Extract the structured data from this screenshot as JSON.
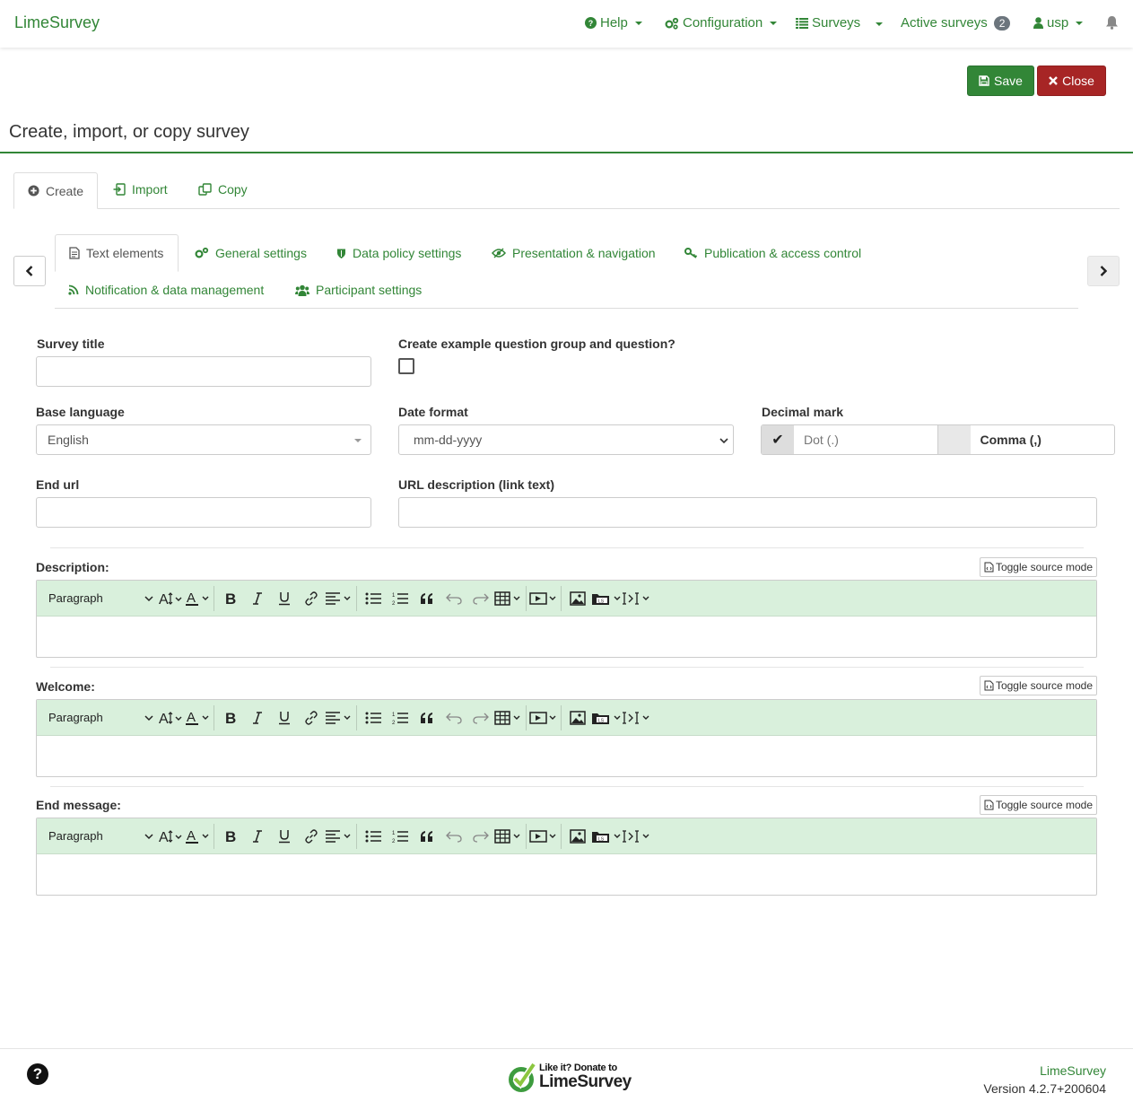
{
  "navbar": {
    "brand": "LimeSurvey",
    "help": "Help",
    "configuration": "Configuration",
    "surveys": "Surveys",
    "active_surveys": "Active surveys",
    "active_count": "2",
    "user": "usp"
  },
  "toolbar": {
    "save": "Save",
    "close": "Close"
  },
  "page_title": "Create, import, or copy survey",
  "main_tabs": [
    {
      "label": "Create",
      "active": true
    },
    {
      "label": "Import"
    },
    {
      "label": "Copy"
    }
  ],
  "sub_tabs": [
    {
      "label": "Text elements",
      "active": true
    },
    {
      "label": "General settings"
    },
    {
      "label": "Data policy settings"
    },
    {
      "label": "Presentation & navigation"
    },
    {
      "label": "Publication & access control"
    },
    {
      "label": "Notification & data management"
    },
    {
      "label": "Participant settings"
    }
  ],
  "form": {
    "survey_title_label": "Survey title",
    "survey_title_value": "",
    "example_label": "Create example question group and question?",
    "example_checked": false,
    "base_language_label": "Base language",
    "base_language_value": "English",
    "date_format_label": "Date format",
    "date_format_value": "mm-dd-yyyy",
    "decimal_label": "Decimal mark",
    "decimal_dot": "Dot (.)",
    "decimal_comma": "Comma (,)",
    "decimal_selected": "dot",
    "end_url_label": "End url",
    "end_url_value": "",
    "url_desc_label": "URL description (link text)",
    "url_desc_value": ""
  },
  "editors": {
    "toggle_label": "Toggle source mode",
    "paragraph": "Paragraph",
    "description_label": "Description:",
    "welcome_label": "Welcome:",
    "end_label": "End message:"
  },
  "footer": {
    "donate_small": "Like it? Donate to",
    "donate_big": "LimeSurvey",
    "brand": "LimeSurvey",
    "version": "Version 4.2.7+200604"
  },
  "colors": {
    "accent": "#328637",
    "danger": "#a72525",
    "toolbar_bg": "#d9f0dc"
  }
}
